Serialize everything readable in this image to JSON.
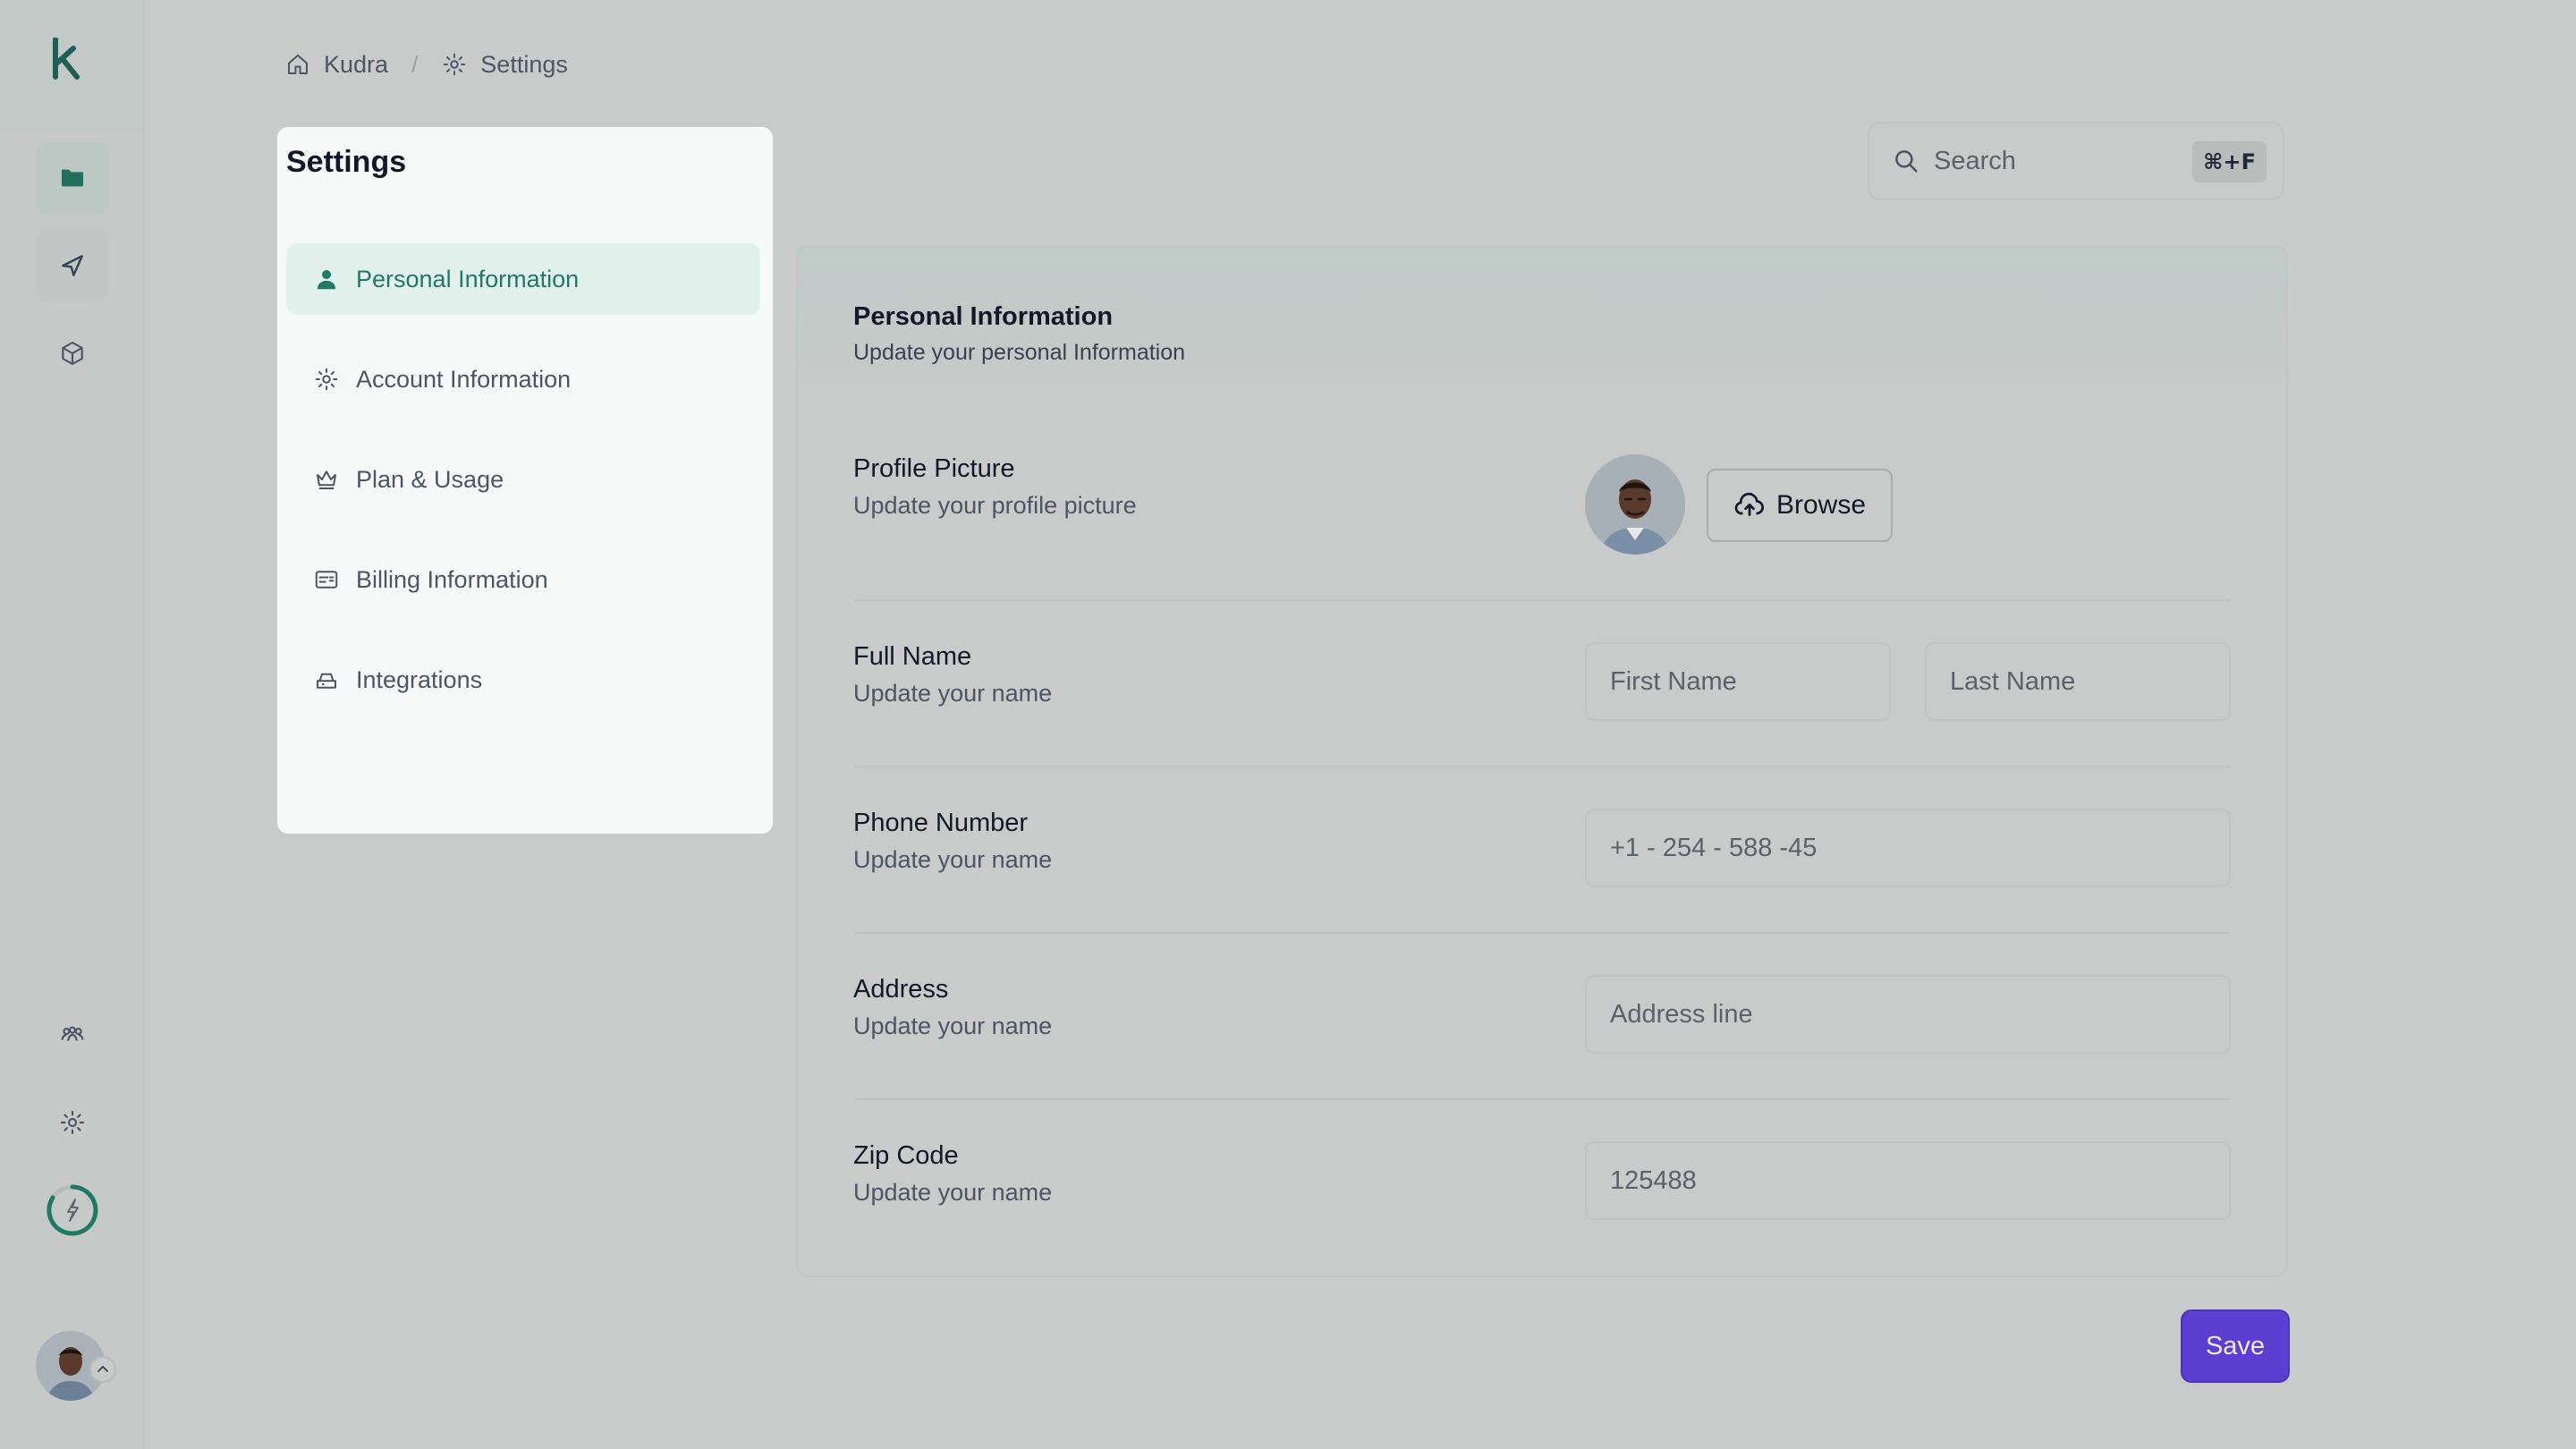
{
  "colors": {
    "accent": "#1f7a63",
    "active_nav_bg": "#e3f1ed",
    "save_button": "#5b3fd1",
    "background": "#c9cbca"
  },
  "rail": {
    "logo": "k-logo-icon",
    "items": [
      {
        "icon": "folder-icon"
      },
      {
        "icon": "send-icon"
      },
      {
        "icon": "cube-icon"
      },
      {
        "icon": "team-icon"
      },
      {
        "icon": "gear-icon"
      },
      {
        "icon": "power-progress-icon"
      }
    ],
    "avatar": "user-avatar"
  },
  "breadcrumb": [
    {
      "label": "Kudra",
      "icon": "home-icon"
    },
    {
      "label": "Settings",
      "icon": "gear-icon"
    }
  ],
  "settings_nav": {
    "title": "Settings",
    "items": [
      {
        "label": "Personal Information",
        "icon": "user-icon",
        "active": true
      },
      {
        "label": "Account Information",
        "icon": "gear-icon",
        "active": false
      },
      {
        "label": "Plan & Usage",
        "icon": "crown-icon",
        "active": false
      },
      {
        "label": "Billing Information",
        "icon": "billing-icon",
        "active": false
      },
      {
        "label": "Integrations",
        "icon": "integrations-icon",
        "active": false
      }
    ]
  },
  "search": {
    "placeholder": "Search",
    "shortcut": "⌘+F"
  },
  "panel": {
    "title": "Personal Information",
    "subtitle": "Update your personal Information",
    "profile": {
      "label": "Profile Picture",
      "sub": "Update your profile picture",
      "browse_label": "Browse"
    },
    "full_name": {
      "label": "Full Name",
      "sub": "Update your name",
      "first_placeholder": "First Name",
      "last_placeholder": "Last Name"
    },
    "phone": {
      "label": "Phone Number",
      "sub": "Update your name",
      "placeholder": "+1 - 254 - 588 -45"
    },
    "address": {
      "label": "Address",
      "sub": "Update your name",
      "placeholder": "Address line"
    },
    "zip": {
      "label": "Zip Code",
      "sub": "Update your name",
      "placeholder": "125488"
    }
  },
  "save_label": "Save"
}
